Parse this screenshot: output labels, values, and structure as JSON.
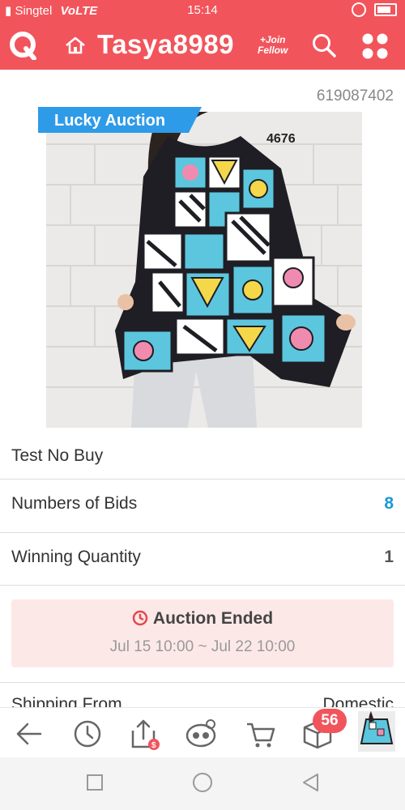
{
  "status_bar": {
    "carrier": "Singtel",
    "network": "VoLTE",
    "time": "15:14"
  },
  "header": {
    "title": "Tasya8989",
    "join_line1": "+Join",
    "join_line2": "Fellow"
  },
  "product": {
    "id": "619087402",
    "tag": "Lucky Auction",
    "image_code": "4676",
    "name": "Test No Buy"
  },
  "details": [
    {
      "label": "Numbers of Bids",
      "value": "8",
      "color": "#1a9ad6"
    },
    {
      "label": "Winning Quantity",
      "value": "1",
      "color": "#555555"
    }
  ],
  "auction": {
    "status": "Auction Ended",
    "dates": "Jul 15 10:00 ~ Jul 22 10:00"
  },
  "shipping": {
    "label": "Shipping From",
    "value": "Domestic"
  },
  "bottom_bar": {
    "icons": [
      "back-arrow-icon",
      "history-clock-icon",
      "share-upload-icon",
      "messenger-icon",
      "cart-icon",
      "box-icon"
    ],
    "box_badge": "56"
  },
  "colors": {
    "brand": "#f2545b",
    "accent_blue": "#1a9ad6",
    "auction_bg": "#fde8e8"
  }
}
